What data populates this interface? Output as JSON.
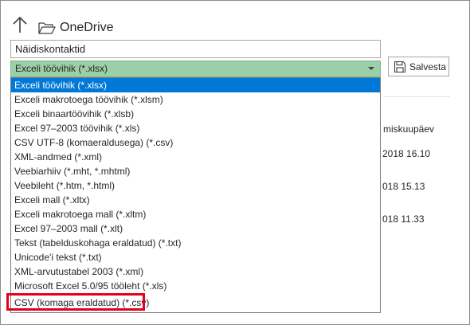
{
  "header": {
    "back_icon": "up-arrow-icon",
    "folder_icon": "folder-open-icon",
    "location": "OneDrive"
  },
  "filename": {
    "value": "Näidiskontaktid"
  },
  "file_type": {
    "selected": "Exceli töövihik (*.xlsx)",
    "options": [
      "Exceli töövihik (*.xlsx)",
      "Exceli makrotoega töövihik (*.xlsm)",
      "Exceli binaartöövihik (*.xlsb)",
      "Excel 97–2003 töövihik (*.xls)",
      "CSV UTF-8 (komaeraldusega) (*.csv)",
      "XML-andmed (*.xml)",
      "Veebiarhiiv (*.mht, *.mhtml)",
      "Veebileht (*.htm, *.html)",
      "Exceli mall (*.xltx)",
      "Exceli makrotoega mall (*.xltm)",
      "Excel 97–2003 mall (*.xlt)",
      "Tekst (tabelduskohaga eraldatud) (*.txt)",
      "Unicode'i tekst (*.txt)",
      "XML-arvutustabel 2003 (*.xml)",
      "Microsoft Excel 5.0/95 tööleht (*.xls)",
      "CSV (komaga eraldatud) (*.csv)"
    ],
    "highlighted_index": 15
  },
  "save_button": {
    "label": "Salvesta",
    "icon": "save-icon"
  },
  "background_list": {
    "header": "miskuupäev",
    "dates": [
      "2018 16.10",
      "018 15.13",
      "018 11.33"
    ]
  },
  "colors": {
    "select_bg": "#9bcfa7",
    "selected_option": "#0078d7",
    "highlight_border": "#e3001b"
  }
}
